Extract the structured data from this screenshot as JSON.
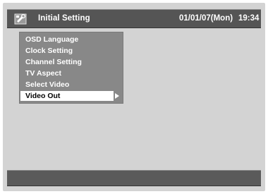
{
  "header": {
    "title": "Initial Setting",
    "date": "01/01/07(Mon)",
    "time": "19:34",
    "icon": "setup-tools-icon"
  },
  "menu": {
    "items": [
      {
        "label": "OSD Language"
      },
      {
        "label": "Clock Setting"
      },
      {
        "label": "Channel Setting"
      },
      {
        "label": "TV Aspect"
      },
      {
        "label": "Select Video"
      },
      {
        "label": "Video Out"
      }
    ],
    "selected_index": 5
  },
  "colors": {
    "panel_bg": "#d3d3d3",
    "bar_bg": "#555555",
    "menu_bg": "#888888",
    "highlight_bg": "#ffffff",
    "text": "#ffffff"
  }
}
